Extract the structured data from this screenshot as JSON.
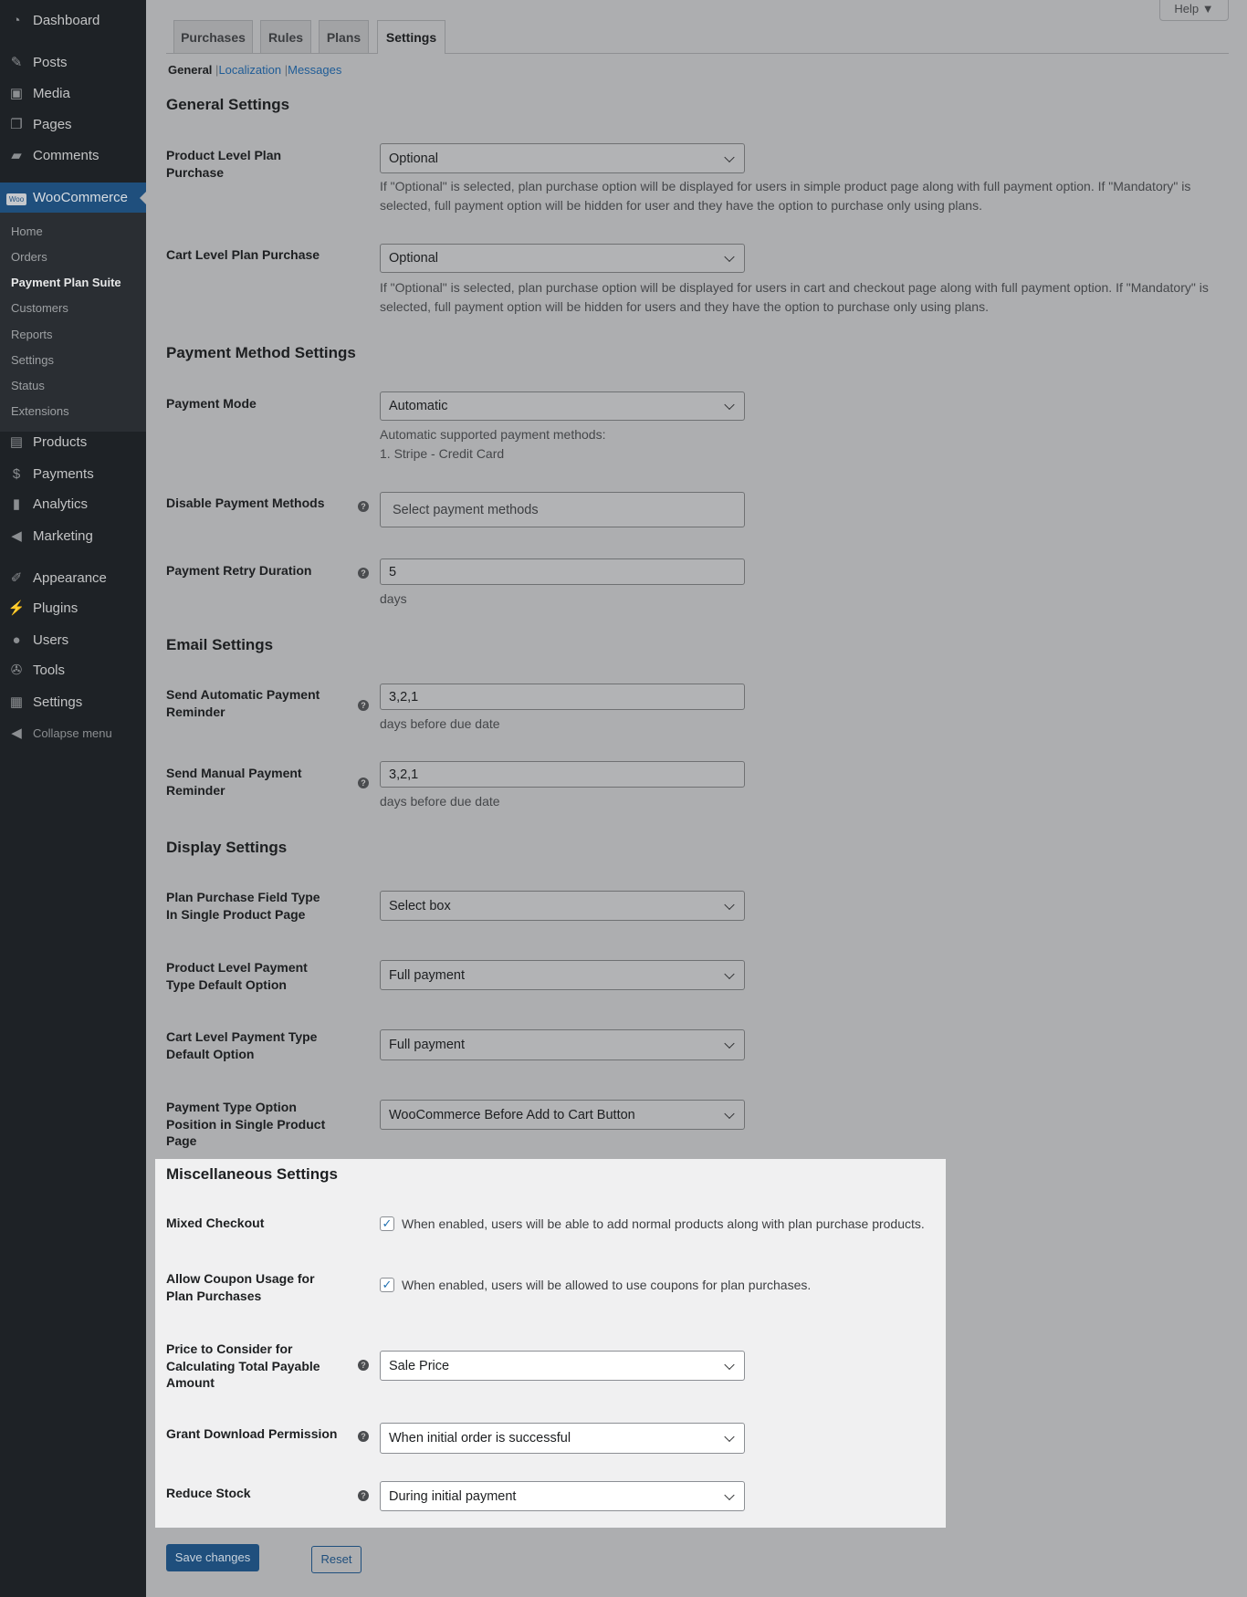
{
  "sidebar": {
    "items": [
      "Dashboard",
      "Posts",
      "Media",
      "Pages",
      "Comments",
      "WooCommerce"
    ],
    "sub": [
      "Home",
      "Orders",
      "Payment Plan Suite",
      "Customers",
      "Reports",
      "Settings",
      "Status",
      "Extensions"
    ],
    "items2": [
      "Products",
      "Payments",
      "Analytics",
      "Marketing",
      "Appearance",
      "Plugins",
      "Users",
      "Tools",
      "Settings",
      "Collapse menu"
    ],
    "woo_badge": "Woo"
  },
  "help": "Help ▼",
  "tabs": [
    "Purchases",
    "Rules",
    "Plans",
    "Settings"
  ],
  "subnav": {
    "general": "General",
    "localization": "Localization",
    "messages": "Messages",
    "sep": "|"
  },
  "sections": {
    "general": "General Settings",
    "payment": "Payment Method Settings",
    "email": "Email Settings",
    "display": "Display Settings",
    "misc": "Miscellaneous Settings"
  },
  "fields": {
    "product_level": {
      "label": "Product Level Plan Purchase",
      "value": "Optional",
      "desc": "If \"Optional\" is selected, plan purchase option will be displayed for users in simple product page along with full payment option. If \"Mandatory\" is selected, full payment option will be hidden for user and they have the option to purchase only using plans."
    },
    "cart_level": {
      "label": "Cart Level Plan Purchase",
      "value": "Optional",
      "desc": "If \"Optional\" is selected, plan purchase option will be displayed for users in cart and checkout page along with full payment option. If \"Mandatory\" is selected, full payment option will be hidden for users and they have the option to purchase only using plans."
    },
    "payment_mode": {
      "label": "Payment Mode",
      "value": "Automatic",
      "desc1": "Automatic supported payment methods:",
      "desc2": "1. Stripe - Credit Card"
    },
    "disable_methods": {
      "label": "Disable Payment Methods",
      "placeholder": "Select payment methods"
    },
    "retry": {
      "label": "Payment Retry Duration",
      "value": "5",
      "desc": "days"
    },
    "auto_reminder": {
      "label": "Send Automatic Payment Reminder",
      "value": "3,2,1",
      "desc": "days before due date"
    },
    "manual_reminder": {
      "label": "Send Manual Payment Reminder",
      "value": "3,2,1",
      "desc": "days before due date"
    },
    "field_type": {
      "label": "Plan Purchase Field Type In Single Product Page",
      "value": "Select box"
    },
    "product_default": {
      "label": "Product Level Payment Type Default Option",
      "value": "Full payment"
    },
    "cart_default": {
      "label": "Cart Level Payment Type Default Option",
      "value": "Full payment"
    },
    "position": {
      "label": "Payment Type Option Position in Single Product Page",
      "value": "WooCommerce Before Add to Cart Button"
    },
    "mixed": {
      "label": "Mixed Checkout",
      "desc": "When enabled, users will be able to add normal products along with plan purchase products.",
      "checked": true
    },
    "coupon": {
      "label": "Allow Coupon Usage for Plan Purchases",
      "desc": "When enabled, users will be allowed to use coupons for plan purchases.",
      "checked": true
    },
    "price": {
      "label": "Price to Consider for Calculating Total Payable Amount",
      "value": "Sale Price"
    },
    "download": {
      "label": "Grant Download Permission",
      "value": "When initial order is successful"
    },
    "stock": {
      "label": "Reduce Stock",
      "value": "During initial payment"
    }
  },
  "buttons": {
    "save": "Save changes",
    "reset": "Reset"
  },
  "help_glyph": "?",
  "check_glyph": "✓"
}
